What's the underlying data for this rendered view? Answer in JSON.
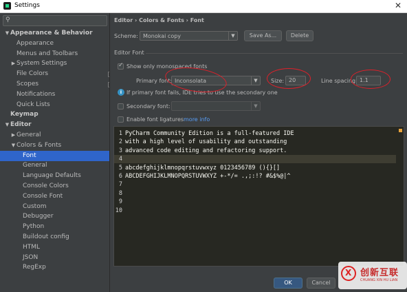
{
  "window": {
    "title": "Settings"
  },
  "sidebar": {
    "search_placeholder": "",
    "items": [
      {
        "label": "Appearance & Behavior",
        "arrow": "▼",
        "bold": true
      },
      {
        "label": "Appearance"
      },
      {
        "label": "Menus and Toolbars"
      },
      {
        "label": "System Settings",
        "arrow": "▶"
      },
      {
        "label": "File Colors",
        "badge": true
      },
      {
        "label": "Scopes",
        "badge": true
      },
      {
        "label": "Notifications"
      },
      {
        "label": "Quick Lists"
      },
      {
        "label": "Keymap",
        "bold": true
      },
      {
        "label": "Editor",
        "arrow": "▼",
        "bold": true
      },
      {
        "label": "General",
        "arrow": "▶"
      },
      {
        "label": "Colors & Fonts",
        "arrow": "▼"
      },
      {
        "label": "Font",
        "selected": true
      },
      {
        "label": "General"
      },
      {
        "label": "Language Defaults"
      },
      {
        "label": "Console Colors"
      },
      {
        "label": "Console Font"
      },
      {
        "label": "Custom"
      },
      {
        "label": "Debugger"
      },
      {
        "label": "Python"
      },
      {
        "label": "Buildout config"
      },
      {
        "label": "HTML"
      },
      {
        "label": "JSON"
      },
      {
        "label": "RegExp"
      }
    ]
  },
  "breadcrumb": "Editor › Colors & Fonts › Font",
  "scheme": {
    "label": "Scheme:",
    "value": "Monokai copy",
    "save_as": "Save As...",
    "delete": "Delete"
  },
  "editor_font": {
    "section_title": "Editor Font",
    "show_monospaced": "Show only monospaced fonts",
    "primary_font_label": "Primary font:",
    "primary_font_value": "Inconsolata",
    "size_label": "Size:",
    "size_value": "20",
    "line_spacing_label": "Line spacing:",
    "line_spacing_value": "1.1",
    "info_text": "If primary font fails, IDE tries to use the secondary one",
    "secondary_font_label": "Secondary font:",
    "ligatures_label": "Enable font ligatures",
    "more_info": "more info"
  },
  "preview": {
    "lines": [
      {
        "num": "1",
        "text": "PyCharm Community Edition is a full-featured IDE"
      },
      {
        "num": "2",
        "text": "with a high level of usability and outstanding"
      },
      {
        "num": "3",
        "text": "advanced code editing and refactoring support."
      },
      {
        "num": "4",
        "text": ""
      },
      {
        "num": "5",
        "text": "abcdefghijklmnopqrstuvwxyz 0123456789 (){}[]"
      },
      {
        "num": "6",
        "text": "ABCDEFGHIJKLMNOPQRSTUVWXYZ +-*/= .,;:!? #&$%@|^"
      },
      {
        "num": "7",
        "text": ""
      },
      {
        "num": "8",
        "text": ""
      },
      {
        "num": "9",
        "text": ""
      },
      {
        "num": "10",
        "text": ""
      }
    ]
  },
  "buttons": {
    "ok": "OK",
    "cancel": "Cancel"
  },
  "watermark": {
    "brand": "创新互联",
    "sub": "CHUANG XIN HU LIAN"
  },
  "colors": {
    "selection": "#2f65ca",
    "annotation": "#e0202a",
    "link": "#589df6"
  }
}
